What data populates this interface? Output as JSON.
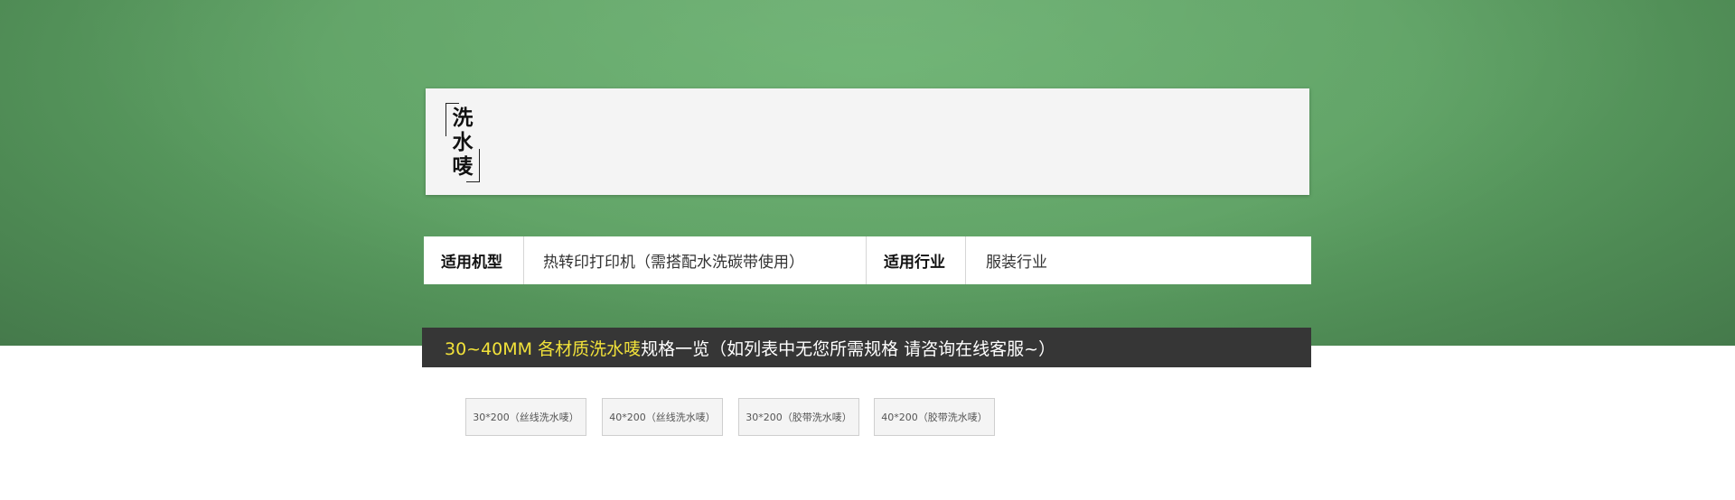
{
  "title": {
    "text": "洗水唛"
  },
  "spec": {
    "model_label": "适用机型",
    "model_value": "热转印打印机（需搭配水洗碳带使用）",
    "industry_label": "适用行业",
    "industry_value": "服装行业"
  },
  "banner": {
    "highlight": "30~40MM 各材质洗水唛",
    "rest": "规格一览（如列表中无您所需规格 请咨询在线客服~）"
  },
  "chips": [
    {
      "label": "30*200（丝线洗水唛）"
    },
    {
      "label": "40*200（丝线洗水唛）"
    },
    {
      "label": "30*200（胶带洗水唛）"
    },
    {
      "label": "40*200（胶带洗水唛）"
    }
  ],
  "colors": {
    "hero_green": "#5ea264",
    "banner_bg": "#363636",
    "banner_highlight": "#f2e23a"
  }
}
